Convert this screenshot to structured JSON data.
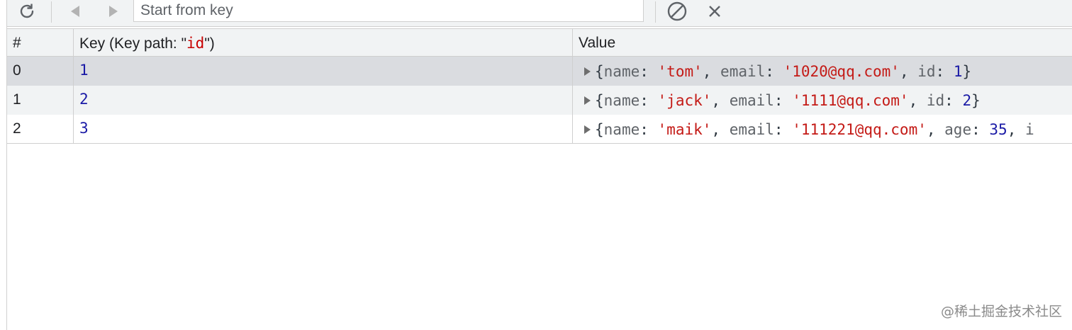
{
  "toolbar": {
    "refresh_icon": "refresh-icon",
    "prev_icon": "triangle-left-icon",
    "next_icon": "triangle-right-icon",
    "start_key_placeholder": "Start from key",
    "clear_icon": "block-icon",
    "close_icon": "close-icon"
  },
  "table": {
    "headers": {
      "index": "#",
      "key_prefix": "Key (Key path: \"",
      "key_path": "id",
      "key_suffix": "\")",
      "value": "Value"
    },
    "rows": [
      {
        "index": "0",
        "key": "1",
        "value": {
          "name": "'tom'",
          "email": "'1020@qq.com'",
          "id": "1"
        }
      },
      {
        "index": "1",
        "key": "2",
        "value": {
          "name": "'jack'",
          "email": "'1111@qq.com'",
          "id": "2"
        }
      },
      {
        "index": "2",
        "key": "3",
        "value": {
          "name": "'maik'",
          "email": "'111221@qq.com'",
          "age": "35",
          "trunc": "i"
        }
      }
    ]
  },
  "watermark": "@稀土掘金技术社区"
}
